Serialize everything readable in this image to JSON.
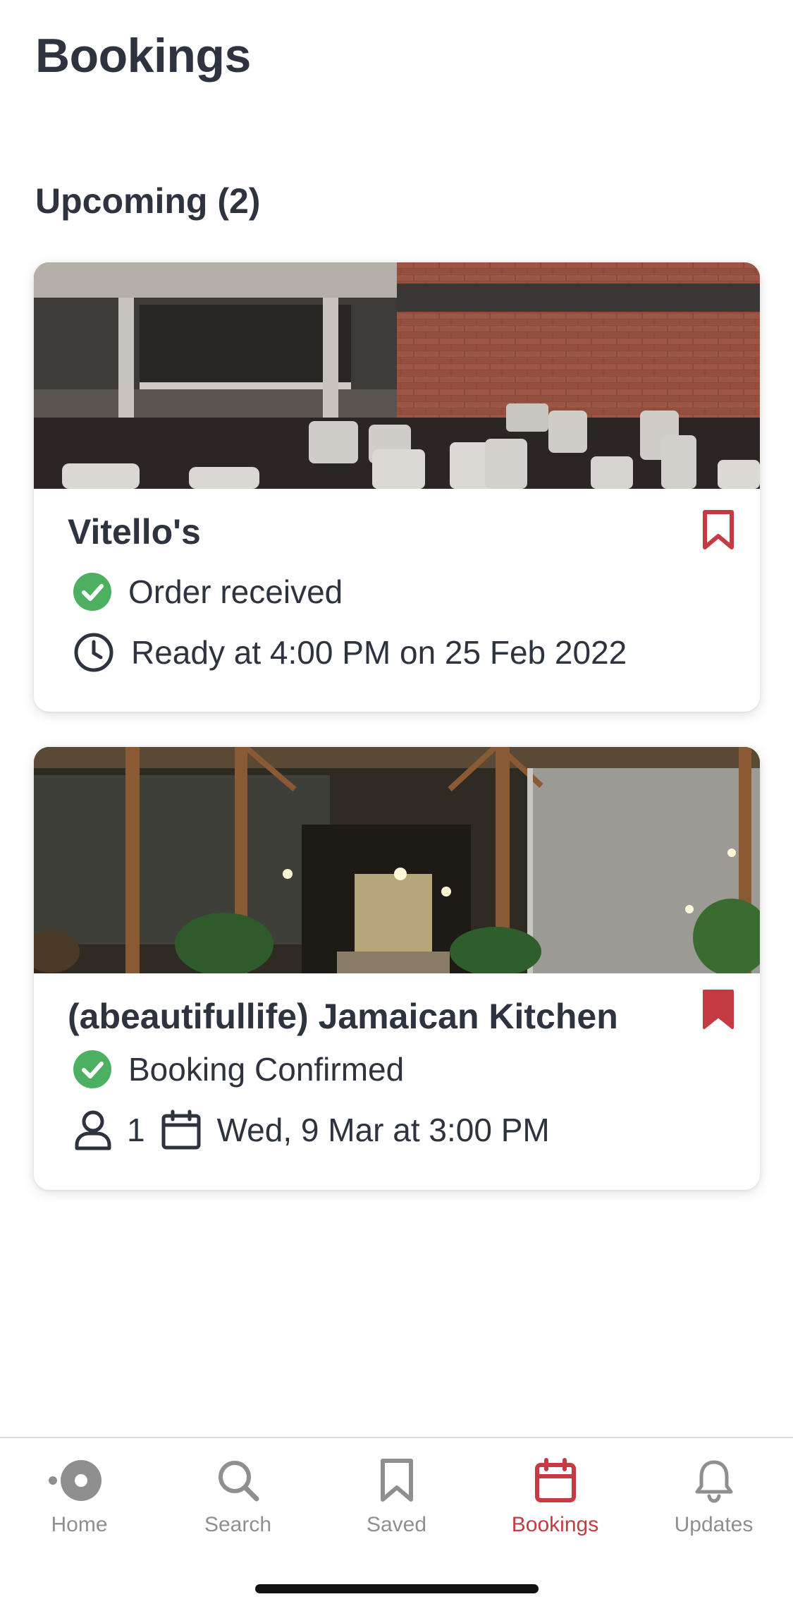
{
  "header": {
    "title": "Bookings"
  },
  "section": {
    "title": "Upcoming (2)"
  },
  "bookings": [
    {
      "name": "Vitello's",
      "status": "Order received",
      "detail": "Ready at 4:00 PM on 25 Feb 2022",
      "saved": false,
      "status_icon": "check-circle-icon",
      "detail_icon": "clock-icon"
    },
    {
      "name": "(abeautifullife) Jamaican Kitchen",
      "status": "Booking Confirmed",
      "party_size": "1",
      "date": "Wed, 9 Mar at 3:00 PM",
      "saved": true,
      "status_icon": "check-circle-icon",
      "party_icon": "person-icon",
      "date_icon": "calendar-icon"
    }
  ],
  "tabbar": {
    "tabs": [
      {
        "label": "Home",
        "icon": "home-icon",
        "active": false
      },
      {
        "label": "Search",
        "icon": "search-icon",
        "active": false
      },
      {
        "label": "Saved",
        "icon": "bookmark-icon",
        "active": false
      },
      {
        "label": "Bookings",
        "icon": "calendar-icon",
        "active": true
      },
      {
        "label": "Updates",
        "icon": "bell-icon",
        "active": false
      }
    ]
  },
  "colors": {
    "accent": "#c63b41",
    "success": "#4caf61",
    "text": "#2d333f",
    "inactive": "#8f8f8f"
  }
}
